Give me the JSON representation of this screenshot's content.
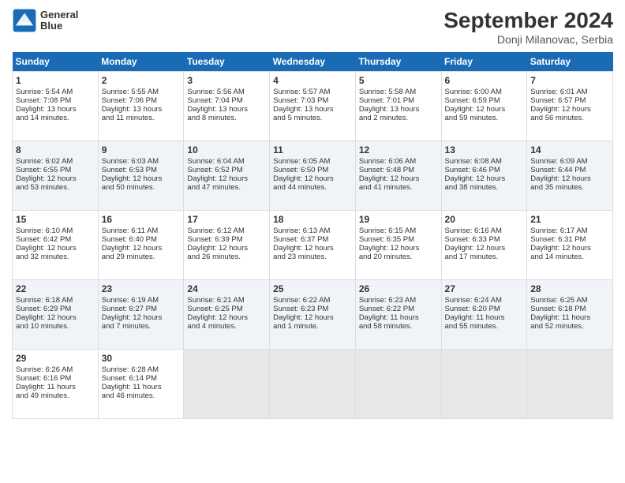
{
  "header": {
    "logo_line1": "General",
    "logo_line2": "Blue",
    "month_title": "September 2024",
    "subtitle": "Donji Milanovac, Serbia"
  },
  "days_of_week": [
    "Sunday",
    "Monday",
    "Tuesday",
    "Wednesday",
    "Thursday",
    "Friday",
    "Saturday"
  ],
  "weeks": [
    [
      {
        "day": "1",
        "lines": [
          "Sunrise: 5:54 AM",
          "Sunset: 7:08 PM",
          "Daylight: 13 hours",
          "and 14 minutes."
        ]
      },
      {
        "day": "2",
        "lines": [
          "Sunrise: 5:55 AM",
          "Sunset: 7:06 PM",
          "Daylight: 13 hours",
          "and 11 minutes."
        ]
      },
      {
        "day": "3",
        "lines": [
          "Sunrise: 5:56 AM",
          "Sunset: 7:04 PM",
          "Daylight: 13 hours",
          "and 8 minutes."
        ]
      },
      {
        "day": "4",
        "lines": [
          "Sunrise: 5:57 AM",
          "Sunset: 7:03 PM",
          "Daylight: 13 hours",
          "and 5 minutes."
        ]
      },
      {
        "day": "5",
        "lines": [
          "Sunrise: 5:58 AM",
          "Sunset: 7:01 PM",
          "Daylight: 13 hours",
          "and 2 minutes."
        ]
      },
      {
        "day": "6",
        "lines": [
          "Sunrise: 6:00 AM",
          "Sunset: 6:59 PM",
          "Daylight: 12 hours",
          "and 59 minutes."
        ]
      },
      {
        "day": "7",
        "lines": [
          "Sunrise: 6:01 AM",
          "Sunset: 6:57 PM",
          "Daylight: 12 hours",
          "and 56 minutes."
        ]
      }
    ],
    [
      {
        "day": "8",
        "lines": [
          "Sunrise: 6:02 AM",
          "Sunset: 6:55 PM",
          "Daylight: 12 hours",
          "and 53 minutes."
        ]
      },
      {
        "day": "9",
        "lines": [
          "Sunrise: 6:03 AM",
          "Sunset: 6:53 PM",
          "Daylight: 12 hours",
          "and 50 minutes."
        ]
      },
      {
        "day": "10",
        "lines": [
          "Sunrise: 6:04 AM",
          "Sunset: 6:52 PM",
          "Daylight: 12 hours",
          "and 47 minutes."
        ]
      },
      {
        "day": "11",
        "lines": [
          "Sunrise: 6:05 AM",
          "Sunset: 6:50 PM",
          "Daylight: 12 hours",
          "and 44 minutes."
        ]
      },
      {
        "day": "12",
        "lines": [
          "Sunrise: 6:06 AM",
          "Sunset: 6:48 PM",
          "Daylight: 12 hours",
          "and 41 minutes."
        ]
      },
      {
        "day": "13",
        "lines": [
          "Sunrise: 6:08 AM",
          "Sunset: 6:46 PM",
          "Daylight: 12 hours",
          "and 38 minutes."
        ]
      },
      {
        "day": "14",
        "lines": [
          "Sunrise: 6:09 AM",
          "Sunset: 6:44 PM",
          "Daylight: 12 hours",
          "and 35 minutes."
        ]
      }
    ],
    [
      {
        "day": "15",
        "lines": [
          "Sunrise: 6:10 AM",
          "Sunset: 6:42 PM",
          "Daylight: 12 hours",
          "and 32 minutes."
        ]
      },
      {
        "day": "16",
        "lines": [
          "Sunrise: 6:11 AM",
          "Sunset: 6:40 PM",
          "Daylight: 12 hours",
          "and 29 minutes."
        ]
      },
      {
        "day": "17",
        "lines": [
          "Sunrise: 6:12 AM",
          "Sunset: 6:39 PM",
          "Daylight: 12 hours",
          "and 26 minutes."
        ]
      },
      {
        "day": "18",
        "lines": [
          "Sunrise: 6:13 AM",
          "Sunset: 6:37 PM",
          "Daylight: 12 hours",
          "and 23 minutes."
        ]
      },
      {
        "day": "19",
        "lines": [
          "Sunrise: 6:15 AM",
          "Sunset: 6:35 PM",
          "Daylight: 12 hours",
          "and 20 minutes."
        ]
      },
      {
        "day": "20",
        "lines": [
          "Sunrise: 6:16 AM",
          "Sunset: 6:33 PM",
          "Daylight: 12 hours",
          "and 17 minutes."
        ]
      },
      {
        "day": "21",
        "lines": [
          "Sunrise: 6:17 AM",
          "Sunset: 6:31 PM",
          "Daylight: 12 hours",
          "and 14 minutes."
        ]
      }
    ],
    [
      {
        "day": "22",
        "lines": [
          "Sunrise: 6:18 AM",
          "Sunset: 6:29 PM",
          "Daylight: 12 hours",
          "and 10 minutes."
        ]
      },
      {
        "day": "23",
        "lines": [
          "Sunrise: 6:19 AM",
          "Sunset: 6:27 PM",
          "Daylight: 12 hours",
          "and 7 minutes."
        ]
      },
      {
        "day": "24",
        "lines": [
          "Sunrise: 6:21 AM",
          "Sunset: 6:25 PM",
          "Daylight: 12 hours",
          "and 4 minutes."
        ]
      },
      {
        "day": "25",
        "lines": [
          "Sunrise: 6:22 AM",
          "Sunset: 6:23 PM",
          "Daylight: 12 hours",
          "and 1 minute."
        ]
      },
      {
        "day": "26",
        "lines": [
          "Sunrise: 6:23 AM",
          "Sunset: 6:22 PM",
          "Daylight: 11 hours",
          "and 58 minutes."
        ]
      },
      {
        "day": "27",
        "lines": [
          "Sunrise: 6:24 AM",
          "Sunset: 6:20 PM",
          "Daylight: 11 hours",
          "and 55 minutes."
        ]
      },
      {
        "day": "28",
        "lines": [
          "Sunrise: 6:25 AM",
          "Sunset: 6:18 PM",
          "Daylight: 11 hours",
          "and 52 minutes."
        ]
      }
    ],
    [
      {
        "day": "29",
        "lines": [
          "Sunrise: 6:26 AM",
          "Sunset: 6:16 PM",
          "Daylight: 11 hours",
          "and 49 minutes."
        ]
      },
      {
        "day": "30",
        "lines": [
          "Sunrise: 6:28 AM",
          "Sunset: 6:14 PM",
          "Daylight: 11 hours",
          "and 46 minutes."
        ]
      },
      {
        "day": "",
        "lines": []
      },
      {
        "day": "",
        "lines": []
      },
      {
        "day": "",
        "lines": []
      },
      {
        "day": "",
        "lines": []
      },
      {
        "day": "",
        "lines": []
      }
    ]
  ]
}
